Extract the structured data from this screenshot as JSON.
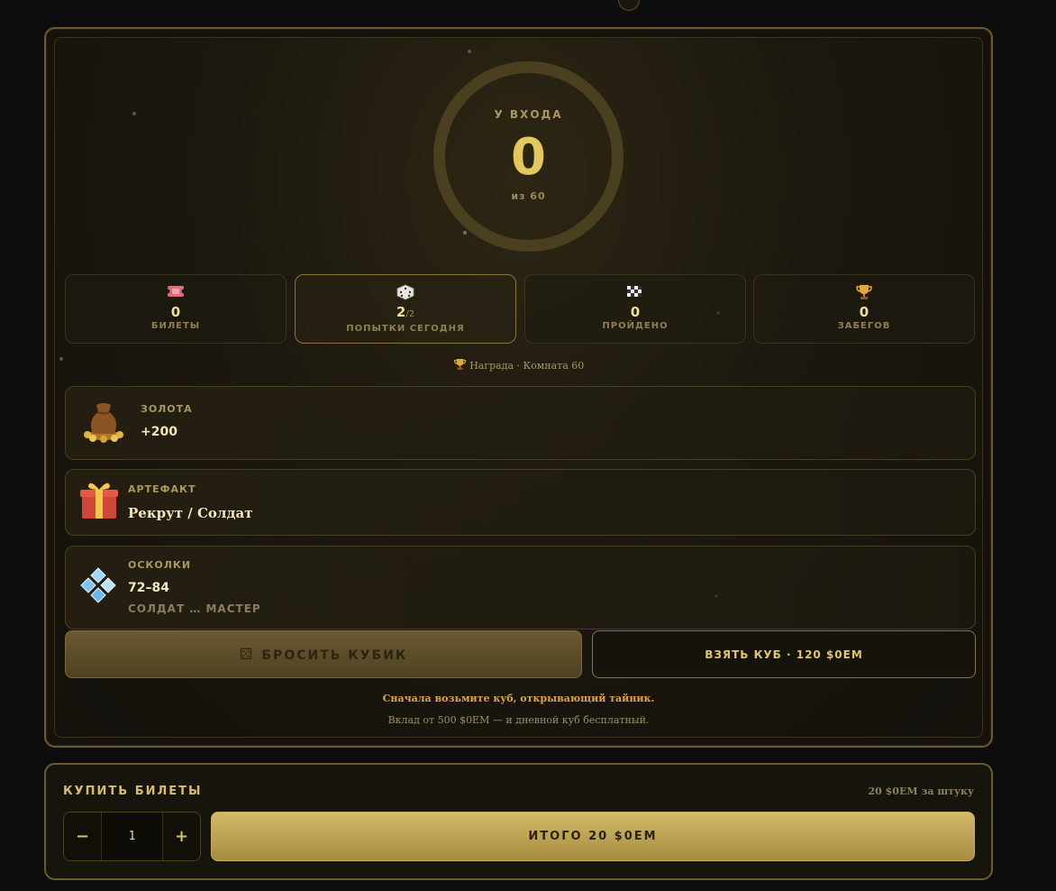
{
  "progress": {
    "caption": "У ВХОДА",
    "value": "0",
    "total_label": "из 60"
  },
  "stats": [
    {
      "icon": "ticket-icon",
      "value": "0",
      "label": "БИЛЕТЫ"
    },
    {
      "icon": "dice-icon",
      "value": "2",
      "value_of": "/2",
      "label": "ПОПЫТКИ СЕГОДНЯ"
    },
    {
      "icon": "checkered-flag-icon",
      "value": "0",
      "label": "ПРОЙДЕНО"
    },
    {
      "icon": "trophy-icon",
      "value": "0",
      "label": "ЗАБЕГОВ"
    }
  ],
  "reward": {
    "title": "Награда · Комната 60",
    "gold": {
      "icon": "gold-bag-icon",
      "title": "ЗОЛОТА",
      "value": "+200"
    },
    "artifact": {
      "icon": "gift-icon",
      "title": "АРТЕФАКТ",
      "value": "Рекрут / Солдат"
    },
    "shards": {
      "icon": "shards-icon",
      "title": "ОСКОЛКИ",
      "value": "72–84",
      "sub": "СОЛДАТ … МАСТЕР"
    }
  },
  "actions": {
    "roll_label": "БРОСИТЬ КУБИК",
    "take_label": "ВЗЯТЬ КУБ · 120 $0EM"
  },
  "hints": {
    "primary": "Сначала возьмите куб, открывающий тайник.",
    "secondary": "Вклад от 500 $0EM — и дневной куб бесплатный."
  },
  "buy": {
    "title": "КУПИТЬ БИЛЕТЫ",
    "price_label": "20 $0EM за штуку",
    "minus": "−",
    "plus": "+",
    "quantity": "1",
    "total_label": "ИТОГО 20 $0EM"
  },
  "colors": {
    "accent": "#e3c85e",
    "panel_border": "#6e5a28",
    "hint": "#d9a441"
  }
}
